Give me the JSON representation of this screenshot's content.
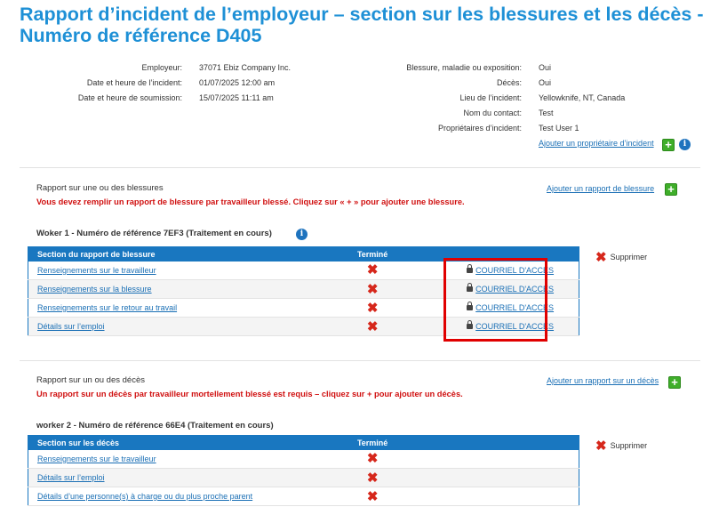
{
  "title": "Rapport d’incident de l’employeur – section sur les blessures et les décès - Numéro de référence D405",
  "info_left": [
    {
      "label": "Employeur:",
      "value": "37071 Ebiz Company Inc."
    },
    {
      "label": "Date et heure de l’incident:",
      "value": "01/07/2025 12:00 am"
    },
    {
      "label": "Date et heure de soumission:",
      "value": "15/07/2025 11:11 am"
    }
  ],
  "info_right": [
    {
      "label": "Blessure, maladie ou exposition:",
      "value": "Oui"
    },
    {
      "label": "Décès:",
      "value": "Oui"
    },
    {
      "label": "Lieu de l’incident:",
      "value": "Yellowknife, NT, Canada"
    },
    {
      "label": "Nom du contact:",
      "value": "Test"
    },
    {
      "label": "Propriétaires d’incident:",
      "value": "Test User 1"
    }
  ],
  "add_owner_link": "Ajouter un propriétaire d’incident",
  "injury": {
    "title": "Rapport sur une ou des blessures",
    "warning": "Vous devez remplir un rapport de blessure par travailleur blessé. Cliquez sur « + » pour ajouter une blessure.",
    "add_link": "Ajouter un rapport de blessure",
    "worker": "Woker 1 - Numéro de référence 7EF3 (Traitement en cours)",
    "col_section": "Section du rapport de blessure",
    "col_done": "Terminé",
    "delete": "Supprimer",
    "rows": [
      {
        "label": "Renseignements sur le travailleur",
        "mark": "✖",
        "access": "COURRIEL D'ACCÈS"
      },
      {
        "label": "Renseignements sur la blessure",
        "mark": "✖",
        "access": "COURRIEL D'ACCÈS"
      },
      {
        "label": "Renseignements sur le retour au travail",
        "mark": "✖",
        "access": "COURRIEL D'ACCÈS"
      },
      {
        "label": "Détails sur l’emploi",
        "mark": "✖",
        "access": "COURRIEL D'ACCÈS"
      }
    ]
  },
  "death": {
    "title": "Rapport sur un ou des décès",
    "warning": "Un rapport sur un décès par travailleur mortellement blessé est requis – cliquez sur + pour ajouter un décès.",
    "add_link": "Ajouter un rapport sur un décès",
    "worker": "worker 2 - Numéro de référence 66E4 (Traitement en cours)",
    "col_section": "Section sur les décès",
    "col_done": "Terminé",
    "delete": "Supprimer",
    "rows": [
      {
        "label": "Renseignements sur le travailleur",
        "mark": "✖"
      },
      {
        "label": "Détails sur l’emploi",
        "mark": "✖"
      },
      {
        "label": "Détails d’une personne(s) à charge ou du plus proche parent",
        "mark": "✖"
      }
    ]
  },
  "icons": {
    "plus": "+",
    "info": "i",
    "plus_icon": "plus-icon",
    "info_icon": "info-icon",
    "lock_icon": "lock-icon",
    "close_icon": "close-icon"
  },
  "colors": {
    "title": "#1e90d6",
    "table_header": "#1977c0",
    "warning": "#d01010",
    "plus": "#3fae2a",
    "highlight": "#e00000"
  }
}
